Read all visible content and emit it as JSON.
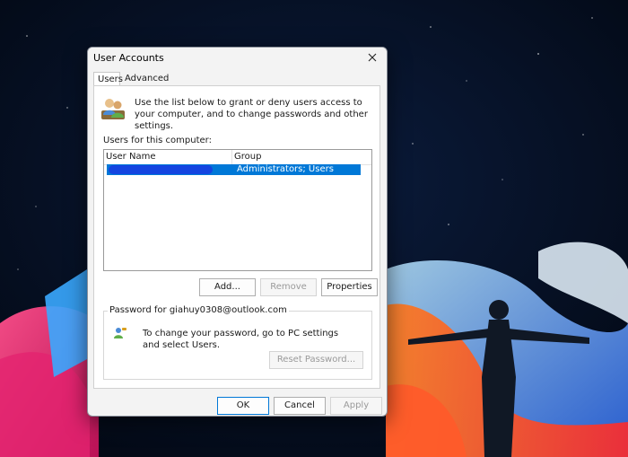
{
  "dialog": {
    "title": "User Accounts"
  },
  "tabs": [
    {
      "label": "Users"
    },
    {
      "label": "Advanced"
    }
  ],
  "intro_text": "Use the list below to grant or deny users access to your computer, and to change passwords and other settings.",
  "users_label": "Users for this computer:",
  "list": {
    "columns": [
      "User Name",
      "Group"
    ],
    "rows": [
      {
        "user_name": "",
        "group": "Administrators; Users"
      }
    ]
  },
  "buttons": {
    "add": "Add...",
    "remove": "Remove",
    "properties": "Properties",
    "reset_password": "Reset Password...",
    "ok": "OK",
    "cancel": "Cancel",
    "apply": "Apply"
  },
  "password_group": {
    "legend": "Password for giahuy0308@outlook.com",
    "text": "To change your password, go to PC settings and select Users."
  },
  "icons": {
    "close": "close-icon",
    "users": "users-icon",
    "password": "password-icon"
  },
  "colors": {
    "selection": "#0078d7",
    "redaction": "#1445e0",
    "desktop_bg": "#06112a"
  }
}
